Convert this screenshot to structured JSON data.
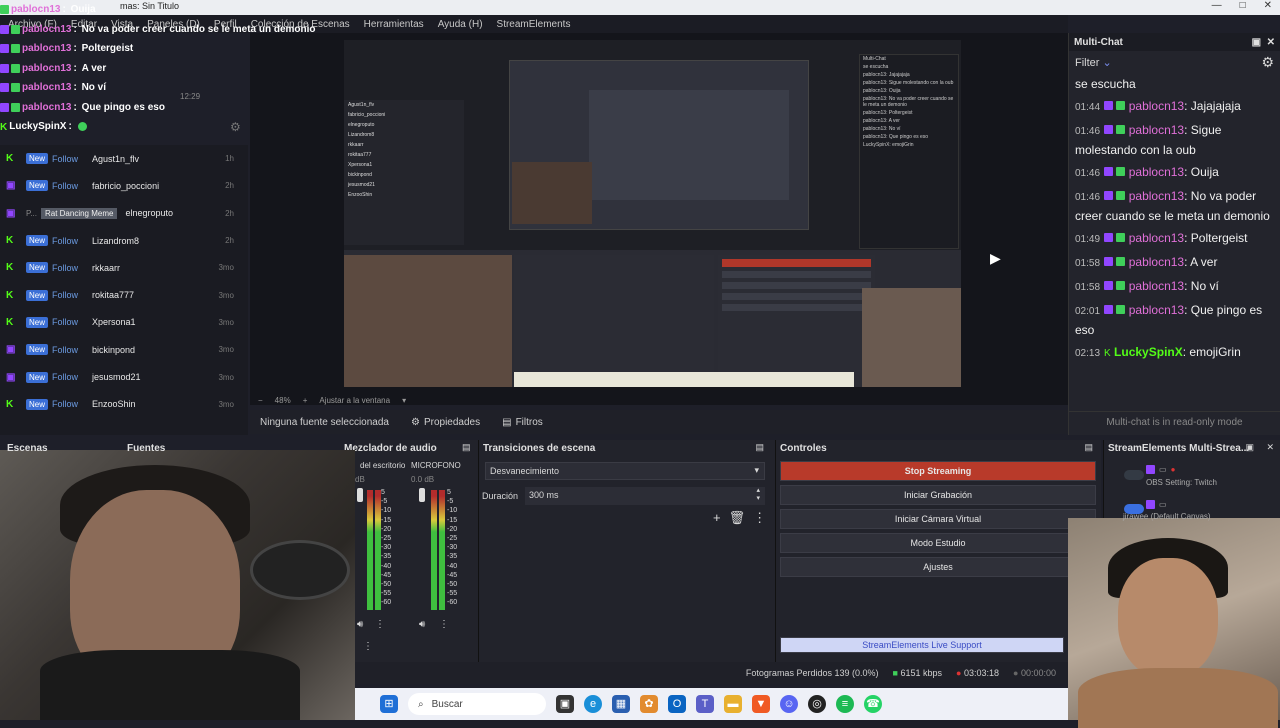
{
  "window": {
    "title": "mas: Sin Titulo",
    "controls": [
      "—",
      "□",
      "✕"
    ]
  },
  "menu": [
    "Archivo (F)",
    "Editar",
    "Vista",
    "Paneles (D)",
    "Perfil",
    "Colección de Escenas",
    "Herramientas",
    "Ayuda (H)",
    "StreamElements"
  ],
  "chat_overlay": [
    {
      "user": "pablocn13",
      "msg": "Ouija"
    },
    {
      "user": "pablocn13",
      "msg": "No va poder creer cuando se le meta un demonio"
    },
    {
      "user": "pablocn13",
      "msg": "Poltergeist"
    },
    {
      "user": "pablocn13",
      "msg": "A ver"
    },
    {
      "user": "pablocn13",
      "msg": "No ví"
    },
    {
      "user": "pablocn13",
      "msg": "Que pingo es eso"
    }
  ],
  "chat_overlay_kick": {
    "user": "LuckySpinX",
    "sep": ":"
  },
  "activity_feed": [
    {
      "platform": "kick",
      "tag": "New",
      "action": "Follow",
      "name": "Agust1n_flv",
      "time": "1h"
    },
    {
      "platform": "twitch",
      "tag": "New",
      "action": "Follow",
      "name": "fabricio_poccioni",
      "time": "2h"
    },
    {
      "platform": "twitch",
      "tag": "P...",
      "action": "Rat Dancing Meme",
      "name": "elnegroputo",
      "time": "2h"
    },
    {
      "platform": "kick",
      "tag": "New",
      "action": "Follow",
      "name": "Lizandrom8",
      "time": "2h"
    },
    {
      "platform": "kick",
      "tag": "New",
      "action": "Follow",
      "name": "rkkaarr",
      "time": "3mo"
    },
    {
      "platform": "kick",
      "tag": "New",
      "action": "Follow",
      "name": "rokitaa777",
      "time": "3mo"
    },
    {
      "platform": "kick",
      "tag": "New",
      "action": "Follow",
      "name": "Xpersona1",
      "time": "3mo"
    },
    {
      "platform": "twitch",
      "tag": "New",
      "action": "Follow",
      "name": "bickinpond",
      "time": "3mo"
    },
    {
      "platform": "twitch",
      "tag": "New",
      "action": "Follow",
      "name": "jesusmod21",
      "time": "3mo"
    },
    {
      "platform": "kick",
      "tag": "New",
      "action": "Follow",
      "name": "EnzooShin",
      "time": "3mo"
    }
  ],
  "multichat": {
    "title": "Multi-Chat",
    "filter": "Filter",
    "first_line": "se escucha",
    "messages": [
      {
        "time": "01:44",
        "user": "pablocn13",
        "msg": "Jajajajaja",
        "platform": "twitch"
      },
      {
        "time": "01:46",
        "user": "pablocn13",
        "msg": "Sigue molestando con la oub",
        "platform": "twitch"
      },
      {
        "time": "01:46",
        "user": "pablocn13",
        "msg": "Ouija",
        "platform": "twitch"
      },
      {
        "time": "01:46",
        "user": "pablocn13",
        "msg": "No va poder creer cuando se le meta un demonio",
        "platform": "twitch"
      },
      {
        "time": "01:49",
        "user": "pablocn13",
        "msg": "Poltergeist",
        "platform": "twitch"
      },
      {
        "time": "01:58",
        "user": "pablocn13",
        "msg": "A ver",
        "platform": "twitch"
      },
      {
        "time": "01:58",
        "user": "pablocn13",
        "msg": "No ví",
        "platform": "twitch"
      },
      {
        "time": "02:01",
        "user": "pablocn13",
        "msg": "Que pingo es eso",
        "platform": "twitch"
      },
      {
        "time": "02:13",
        "user": "LuckySpinX",
        "msg": "emojiGrin",
        "platform": "kick"
      }
    ],
    "readonly": "Multi-chat is in read-only mode"
  },
  "zoom": {
    "value": "48%",
    "fit": "Ajustar a la ventana"
  },
  "source_toolbar": {
    "none": "Ninguna fuente seleccionada",
    "properties": "Propiedades",
    "filters": "Filtros"
  },
  "docks": {
    "scenes": "Escenas",
    "sources": "Fuentes",
    "mixer": "Mezclador de audio",
    "transitions": "Transiciones de escena",
    "controls": "Controles",
    "se": "StreamElements Multi-Strea..."
  },
  "mixer": {
    "ch1": "del escritorio",
    "ch2": "MICROFONO",
    "ch2_db": "0.0 dB",
    "ch1_db": "dB",
    "scale": [
      "5",
      "-5",
      "-10",
      "-15",
      "-20",
      "-25",
      "-30",
      "-35",
      "-40",
      "-45",
      "-50",
      "-55",
      "-60"
    ]
  },
  "transitions": {
    "selected": "Desvanecimiento",
    "duration_label": "Duración",
    "duration": "300 ms"
  },
  "controls": {
    "stop": "Stop Streaming",
    "record": "Iniciar Grabación",
    "virtualcam": "Iniciar Cámara Virtual",
    "studio": "Modo Estudio",
    "settings": "Ajustes",
    "support": "StreamElements Live Support"
  },
  "se_panel": {
    "row1": "OBS Setting: Twitch",
    "row2": "jirawee (Default Canvas)"
  },
  "status": {
    "dropped": "Fotogramas Perdidos 139 (0.0%)",
    "kbps": "6151 kbps",
    "live": "03:03:18",
    "rec": "00:00:00"
  },
  "taskbar": {
    "search": "Buscar"
  },
  "preview_overlay": {
    "clock": "12:29"
  },
  "colors": {
    "accent_stop": "#b83a2a",
    "twitch": "#9146ff",
    "kick": "#53fc18",
    "username": "#e070d8"
  }
}
